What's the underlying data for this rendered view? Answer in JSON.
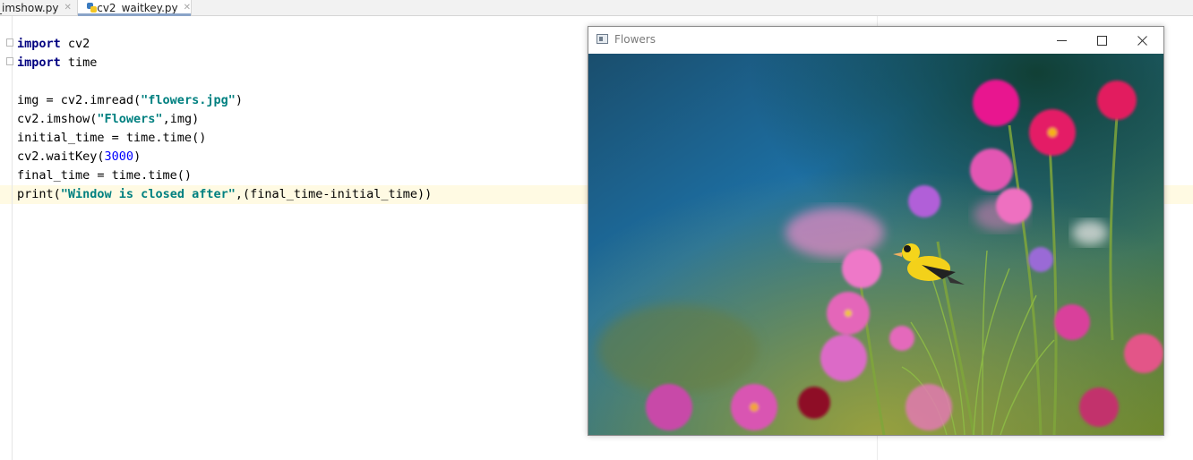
{
  "tabs": [
    {
      "label": "_imshow.py",
      "active": false
    },
    {
      "label": "cv2_waitkey.py",
      "active": true
    }
  ],
  "tab_close_glyph": "✕",
  "code": {
    "line1": {
      "kw": "import",
      "rest": " cv2"
    },
    "line2": {
      "kw": "import",
      "rest": " time"
    },
    "line4": {
      "pre": "img = cv2.imread(",
      "str": "\"flowers.jpg\"",
      "post": ")"
    },
    "line5": {
      "pre": "cv2.imshow(",
      "str": "\"Flowers\"",
      "post": ",img)"
    },
    "line6": {
      "text": "initial_time = time.time()"
    },
    "line7": {
      "pre": "cv2.waitKey(",
      "num": "3000",
      "post": ")"
    },
    "line8": {
      "text": "final_time = time.time()"
    },
    "line9": {
      "pre": "print(",
      "str": "\"Window is closed after\"",
      "post": ",(final_time-initial_time))"
    }
  },
  "image_window": {
    "title": "Flowers",
    "image_icon": "flowers-bird-photo",
    "controls": {
      "minimize_icon": "minimize-icon",
      "maximize_icon": "maximize-icon",
      "close_icon": "close-icon"
    }
  },
  "colors": {
    "keyword": "#000080",
    "string": "#008080",
    "number": "#0000ff",
    "current_line": "#fffae3"
  }
}
